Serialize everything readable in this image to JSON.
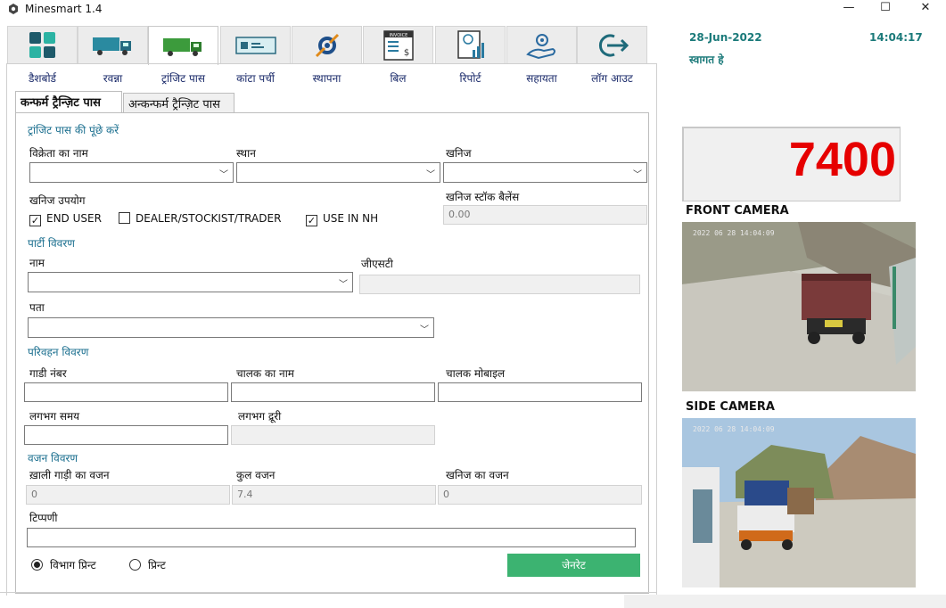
{
  "window": {
    "title": "Minesmart 1.4",
    "minimize": "—",
    "maximize": "☐",
    "close": "✕"
  },
  "toolbar": [
    {
      "label": "डैशबोर्ड",
      "icon": "dashboard-icon"
    },
    {
      "label": "रवन्ना",
      "icon": "truck-icon"
    },
    {
      "label": "ट्रांजिट पास",
      "icon": "truck-green-icon"
    },
    {
      "label": "कांटा पर्ची",
      "icon": "ticket-icon"
    },
    {
      "label": "स्थापना",
      "icon": "settings-tools-icon"
    },
    {
      "label": "बिल",
      "icon": "invoice-icon"
    },
    {
      "label": "रिपोर्ट",
      "icon": "report-icon"
    },
    {
      "label": "सहायता",
      "icon": "help-hand-icon"
    },
    {
      "label": "लॉग आउट",
      "icon": "logout-icon"
    }
  ],
  "header": {
    "date": "28-Jun-2022",
    "time": "14:04:17",
    "welcome": "स्वागत हे"
  },
  "tabs": {
    "confirm": "कन्फर्म  ट्रैन्ज़िट पास",
    "unconfirm": "अन्कन्फर्म ट्रैन्ज़िट पास"
  },
  "form": {
    "section_query": "ट्रांजिट पास की पूंछे करें",
    "vendor_label": "विक्रेता का नाम",
    "place_label": "स्थान",
    "mineral_label": "खनिज",
    "mineral_use_label": "खनिज उपयोग",
    "stock_balance_label": "खनिज स्टॉक बैलेंस",
    "stock_balance_value": "0.00",
    "checks": [
      {
        "label": "END USER",
        "checked": true
      },
      {
        "label": "DEALER/STOCKIST/TRADER",
        "checked": false
      },
      {
        "label": "USE IN NH",
        "checked": true
      }
    ],
    "section_party": "पार्टी विवरण",
    "name_label": "नाम",
    "gst_label": "जीएसटी",
    "address_label": "पता",
    "section_transport": "परिवहन विवरण",
    "vehicle_label": "गाडी नंबर",
    "driver_label": "चालक का नाम",
    "driver_mobile_label": "चालक मोबाइल",
    "approx_time_label": "लगभग समय",
    "approx_distance_label": "लगभग द्रूरी",
    "section_weight": "वजन विवरण",
    "empty_weight_label": "ख़ाली गाड़ी का वजन",
    "empty_weight_value": "0",
    "total_weight_label": "कुल वजन",
    "total_weight_value": "7.4",
    "mineral_weight_label": "खनिज का वजन",
    "mineral_weight_value": "0",
    "remarks_label": "टिप्पणी",
    "print_options": [
      {
        "label": "विभाग प्रिन्ट",
        "selected": true
      },
      {
        "label": "प्रिन्ट",
        "selected": false
      }
    ],
    "generate_label": "जेनरेट"
  },
  "scale": {
    "weight": "7400",
    "weight_color": "#e60000"
  },
  "cameras": {
    "front": {
      "title": "FRONT CAMERA",
      "timestamp": "2022 06 28 14:04:09"
    },
    "side": {
      "title": "SIDE CAMERA",
      "timestamp": "2022 06 28 14:04:09"
    }
  },
  "colors": {
    "accent": "#1b7a7a",
    "generate": "#3cb371",
    "section": "#1b6f8f"
  }
}
